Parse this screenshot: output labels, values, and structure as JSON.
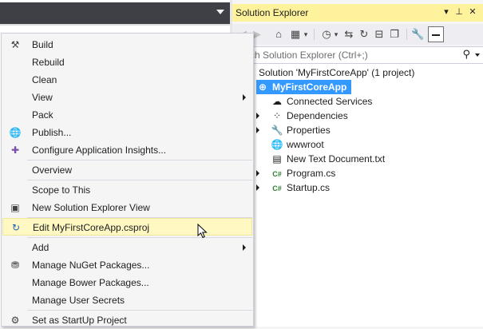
{
  "solution_explorer": {
    "title": "Solution Explorer",
    "search_placeholder": "Search Solution Explorer (Ctrl+;)",
    "search_placeholder_visible": "ch Solution Explorer (Ctrl+;)",
    "tree": {
      "solution": "Solution 'MyFirstCoreApp' (1 project)",
      "project": "MyFirstCoreApp",
      "items": [
        "Connected Services",
        "Dependencies",
        "Properties",
        "wwwroot",
        "New Text Document.txt",
        "Program.cs",
        "Startup.cs"
      ]
    }
  },
  "context_menu": {
    "items": [
      {
        "label": "Build",
        "icon": "build-icon"
      },
      {
        "label": "Rebuild"
      },
      {
        "label": "Clean"
      },
      {
        "label": "View",
        "submenu": true
      },
      {
        "label": "Pack"
      },
      {
        "label": "Publish...",
        "icon": "globe-icon"
      },
      {
        "label": "Configure Application Insights...",
        "icon": "insights-icon"
      },
      {
        "label": "Overview"
      },
      {
        "label": "Scope to This"
      },
      {
        "label": "New Solution Explorer View",
        "icon": "new-view-icon"
      },
      {
        "label": "Edit MyFirstCoreApp.csproj",
        "icon": "edit-refresh-icon",
        "highlighted": true
      },
      {
        "label": "Add",
        "submenu": true
      },
      {
        "label": "Manage NuGet Packages...",
        "icon": "nuget-icon"
      },
      {
        "label": "Manage Bower Packages..."
      },
      {
        "label": "Manage User Secrets"
      },
      {
        "label": "Set as StartUp Project",
        "icon": "gear-icon"
      }
    ]
  },
  "colors": {
    "title_highlight": "#fff29d",
    "selection": "#3399ff",
    "menu_highlight": "#fff8c2",
    "menu_background": "#f5f5f5"
  }
}
